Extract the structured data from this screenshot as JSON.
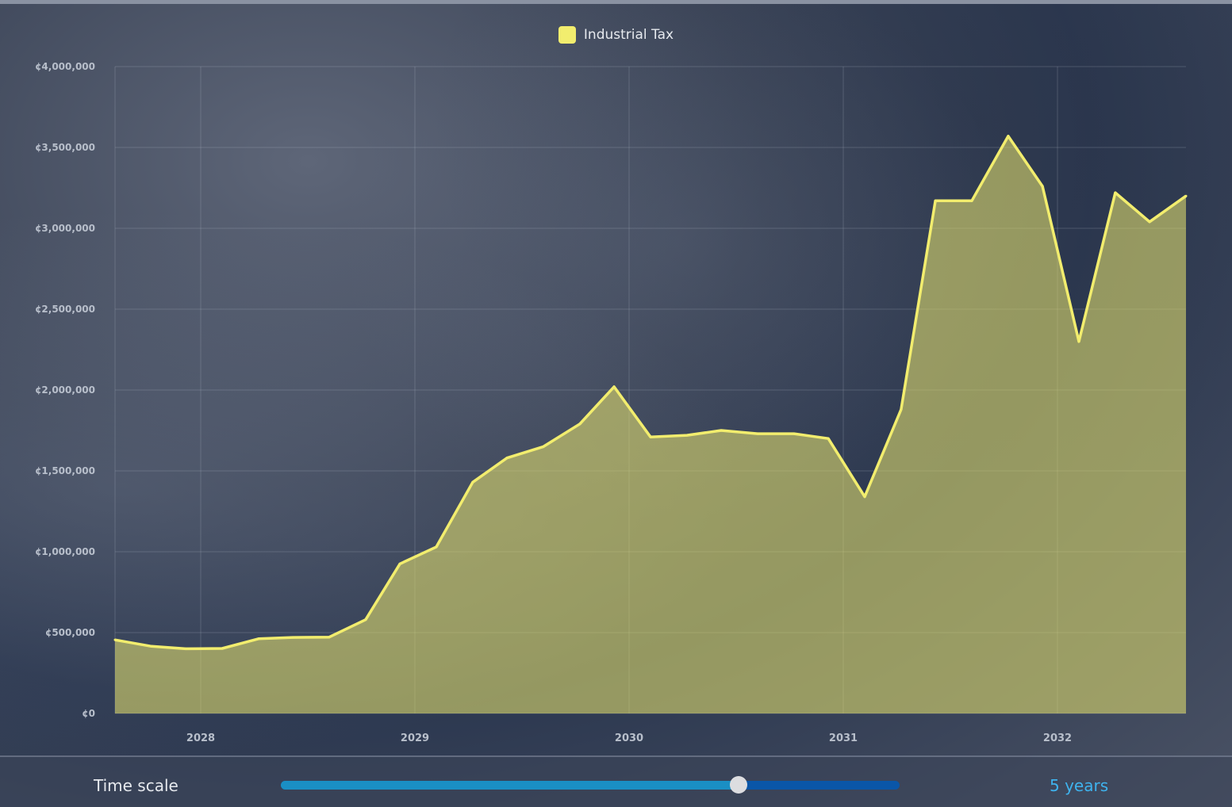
{
  "chart_data": {
    "type": "area",
    "title": "",
    "xlabel": "",
    "ylabel": "",
    "x_tick_labels": [
      "2028",
      "2029",
      "2030",
      "2031",
      "2032"
    ],
    "y_tick_labels": [
      "¢0",
      "¢500,000",
      "¢1,000,000",
      "¢1,500,000",
      "¢2,000,000",
      "¢2,500,000",
      "¢3,000,000",
      "¢3,500,000",
      "¢4,000,000"
    ],
    "ylim": [
      0,
      4000000
    ],
    "xlim": [
      2027.6,
      2032.6
    ],
    "grid": true,
    "legend_position": "top-center",
    "series": [
      {
        "name": "Industrial Tax",
        "color": "#f2ed6e",
        "x": [
          2027.6,
          2027.77,
          2027.93,
          2028.1,
          2028.27,
          2028.43,
          2028.6,
          2028.77,
          2028.93,
          2029.1,
          2029.27,
          2029.43,
          2029.6,
          2029.77,
          2029.93,
          2030.1,
          2030.27,
          2030.43,
          2030.6,
          2030.77,
          2030.93,
          2031.1,
          2031.27,
          2031.43,
          2031.6,
          2031.77,
          2031.93,
          2032.1,
          2032.27,
          2032.43,
          2032.6
        ],
        "values": [
          455000,
          415000,
          400000,
          402000,
          462000,
          470000,
          472000,
          580000,
          925000,
          1030000,
          1430000,
          1580000,
          1650000,
          1790000,
          2020000,
          1710000,
          1720000,
          1750000,
          1730000,
          1730000,
          1700000,
          1340000,
          1880000,
          3170000,
          3170000,
          3570000,
          3260000,
          2300000,
          3220000,
          3040000,
          3200000
        ]
      }
    ]
  },
  "legend": {
    "label": "Industrial Tax",
    "swatch_color": "#f2ed6e"
  },
  "footer": {
    "time_label": "Time scale",
    "time_value": "5 years",
    "slider_fraction": 0.74
  }
}
